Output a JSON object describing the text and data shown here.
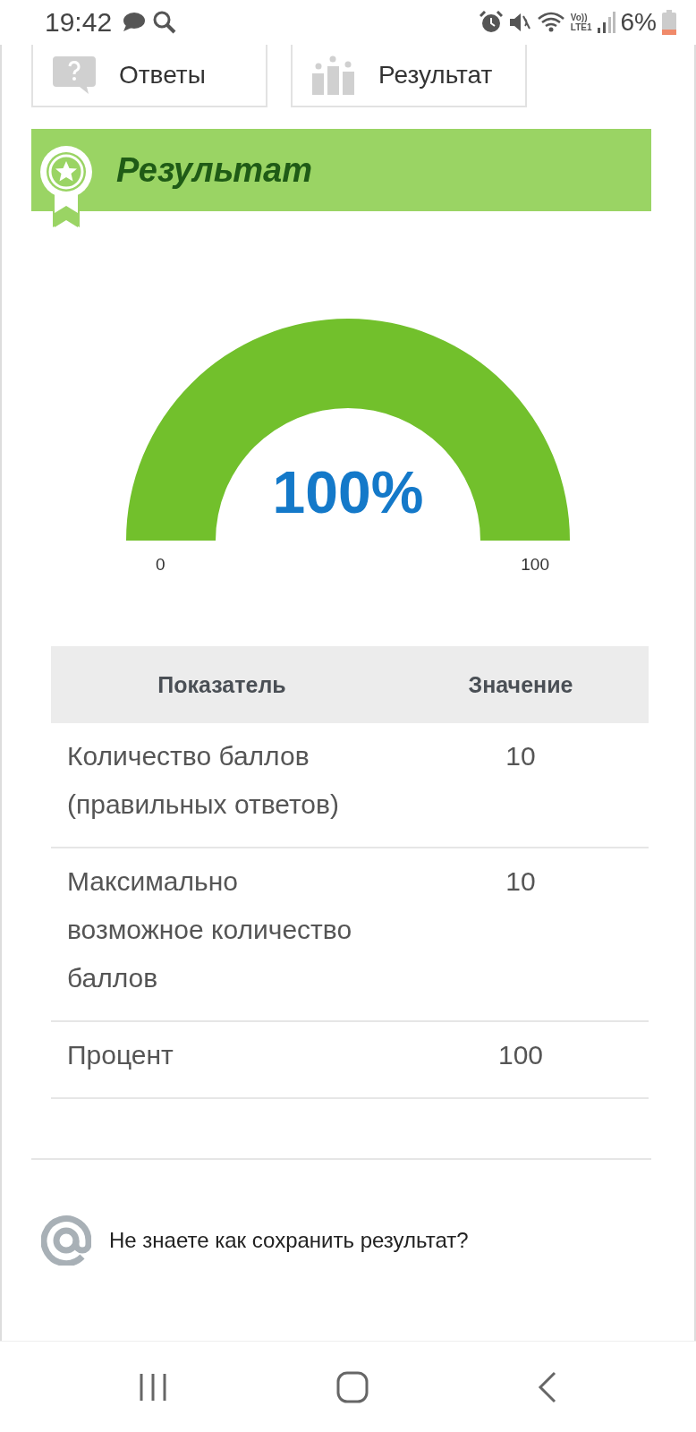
{
  "status_bar": {
    "time": "19:42",
    "volte": "Vo))",
    "lte": "LTE1",
    "battery": "6%"
  },
  "tabs": [
    {
      "label": "Ответы",
      "kind": "answers"
    },
    {
      "label": "Результат",
      "kind": "results"
    }
  ],
  "banner": {
    "title": "Результат"
  },
  "gauge": {
    "value": "100%",
    "min_label": "0",
    "max_label": "100",
    "level": 1
  },
  "table": {
    "columns": [
      "Показатель",
      "Значение"
    ],
    "rows": [
      {
        "label": "Количество баллов (правильных ответов)",
        "value": "10"
      },
      {
        "label": "Максимально возможное количество баллов",
        "value": "10"
      },
      {
        "label": "Процент",
        "value": "100"
      }
    ]
  },
  "email_prompt": {
    "text": "Не знаете как сохранить результат?"
  }
}
